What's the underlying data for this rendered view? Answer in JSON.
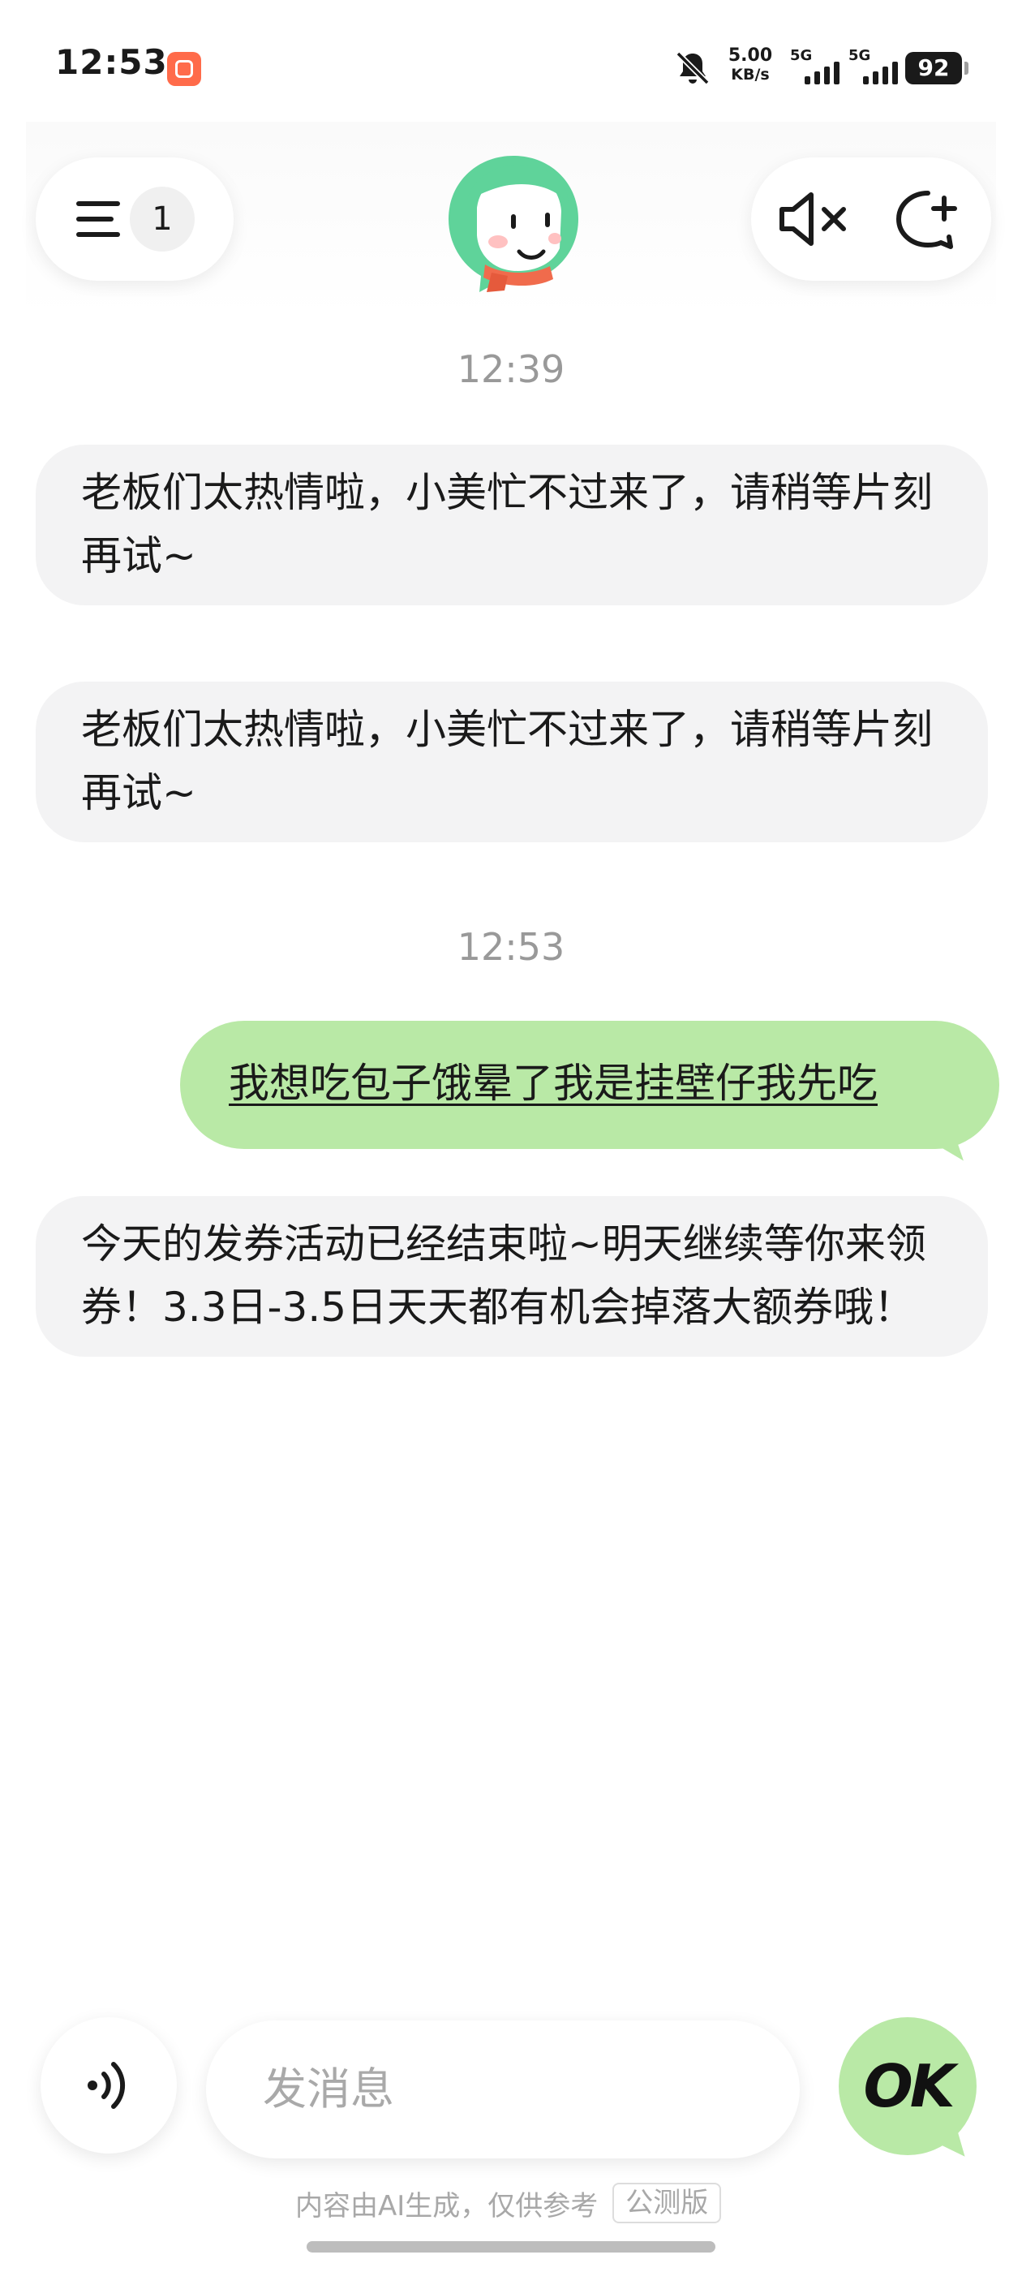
{
  "status_bar": {
    "time": "12:53",
    "net_speed_value": "5.00",
    "net_speed_unit": "KB/s",
    "signal_1_label": "5G",
    "signal_2_label": "5G",
    "battery": "92",
    "icons": [
      "app-icon",
      "bell-off-icon",
      "signal-icon",
      "battery-icon"
    ]
  },
  "header": {
    "conversation_count": "1",
    "icons": [
      "menu-icon",
      "avatar",
      "mute-icon",
      "new-chat-icon"
    ]
  },
  "chat": {
    "timestamp_1": "12:39",
    "bot_message_1": "老板们太热情啦，小美忙不过来了，请稍等片刻再试~",
    "bot_message_2": "老板们太热情啦，小美忙不过来了，请稍等片刻再试~",
    "timestamp_2": "12:53",
    "user_message": "我想吃包子饿晕了我是挂壁仔我先吃",
    "bot_message_3": "今天的发券活动已经结束啦~明天继续等你来领券！3.3日-3.5日天天都有机会掉落大额券哦！"
  },
  "input_bar": {
    "placeholder": "发消息",
    "send_label": "OK"
  },
  "footer": {
    "disclaimer": "内容由AI生成，仅供参考",
    "badge": "公测版"
  },
  "colors": {
    "user_bubble": "#b9e9a6",
    "bot_bubble": "#f3f3f4",
    "timestamp": "#999999",
    "placeholder": "#a9a9a9"
  }
}
